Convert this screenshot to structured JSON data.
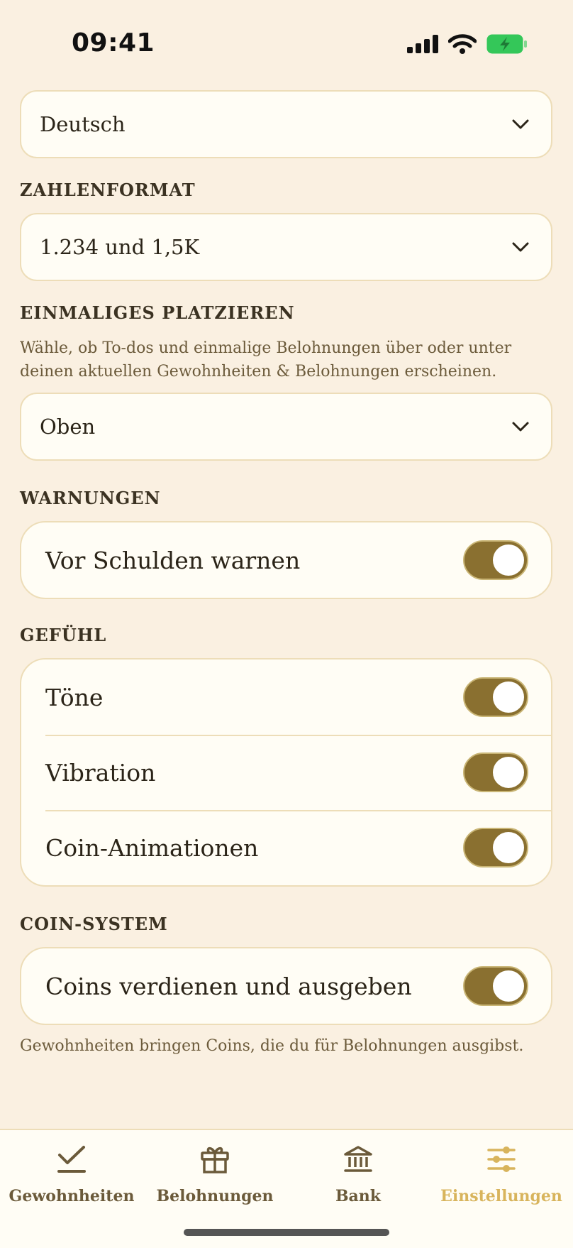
{
  "status_bar": {
    "time": "09:41"
  },
  "language": {
    "value": "Deutsch"
  },
  "number_format": {
    "label": "ZAHLENFORMAT",
    "value": "1.234 und 1,5K"
  },
  "placement": {
    "label": "EINMALIGES PLATZIEREN",
    "description": "Wähle, ob To-dos und einmalige Belohnungen über oder unter deinen aktuellen Gewohnheiten & Belohnungen erscheinen.",
    "value": "Oben"
  },
  "warnings": {
    "label": "WARNUNGEN",
    "items": [
      {
        "label": "Vor Schulden warnen",
        "on": true
      }
    ]
  },
  "feeling": {
    "label": "GEFÜHL",
    "items": [
      {
        "label": "Töne",
        "on": true
      },
      {
        "label": "Vibration",
        "on": true
      },
      {
        "label": "Coin-Animationen",
        "on": true
      }
    ]
  },
  "coin_system": {
    "label": "COIN-SYSTEM",
    "items": [
      {
        "label": "Coins verdienen und ausgeben",
        "on": true
      }
    ],
    "note": "Gewohnheiten bringen Coins, die du für Belohnungen ausgibst."
  },
  "tabs": [
    {
      "label": "Gewohnheiten",
      "icon": "check-icon",
      "active": false
    },
    {
      "label": "Belohnungen",
      "icon": "gift-icon",
      "active": false
    },
    {
      "label": "Bank",
      "icon": "bank-icon",
      "active": false
    },
    {
      "label": "Einstellungen",
      "icon": "sliders-icon",
      "active": true
    }
  ],
  "colors": {
    "background": "#FAF0E1",
    "card": "#FFFDF5",
    "toggle_on": "#8A7030",
    "active_tab": "#D8B45C",
    "battery": "#34C759"
  }
}
